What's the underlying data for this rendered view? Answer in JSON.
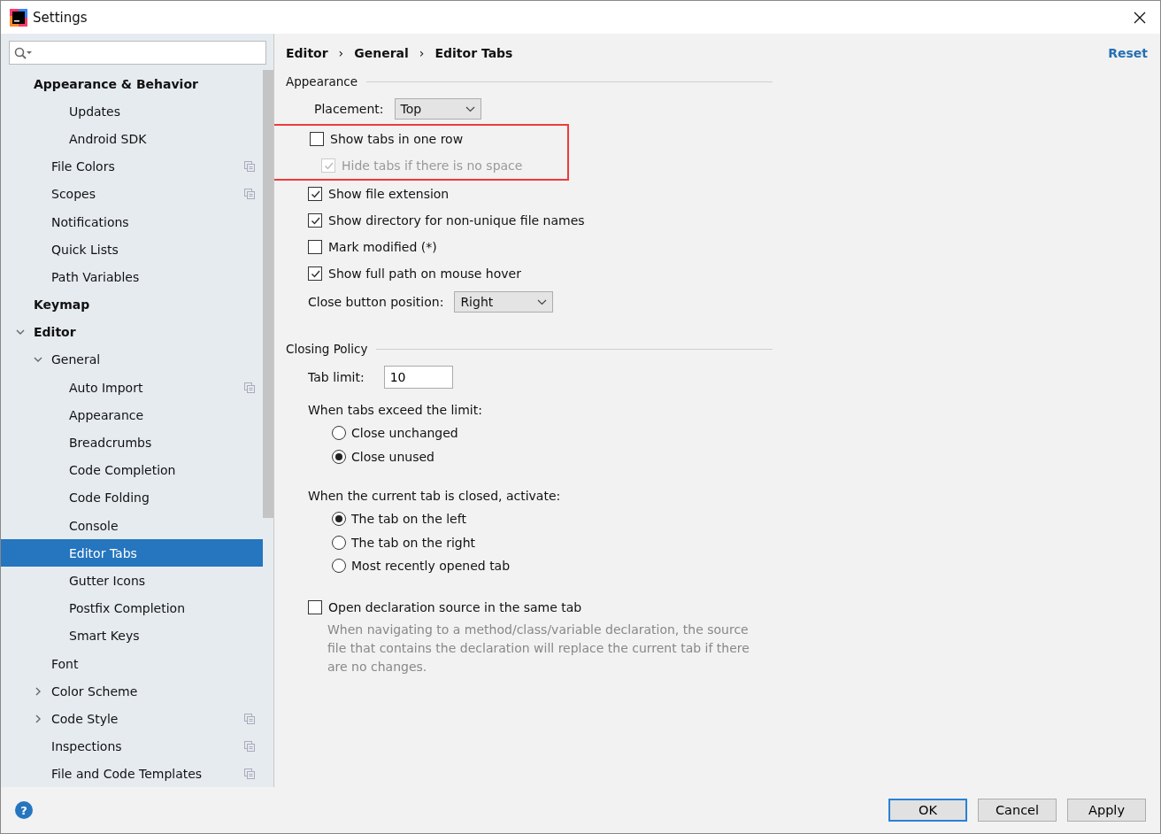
{
  "window": {
    "title": "Settings"
  },
  "sidebar": {
    "items": [
      {
        "label": "Appearance & Behavior",
        "bold": true,
        "selected": false,
        "scoped": false,
        "children": [
          {
            "children": [
              {
                "label": "Updates",
                "selected": false,
                "scoped": false
              },
              {
                "label": "Android SDK",
                "selected": false,
                "scoped": false
              }
            ]
          },
          {
            "label": "File Colors",
            "selected": false,
            "scoped": true
          },
          {
            "label": "Scopes",
            "selected": false,
            "scoped": true
          },
          {
            "label": "Notifications",
            "selected": false,
            "scoped": false
          },
          {
            "label": "Quick Lists",
            "selected": false,
            "scoped": false
          },
          {
            "label": "Path Variables",
            "selected": false,
            "scoped": false
          }
        ]
      },
      {
        "label": "Keymap",
        "bold": true,
        "selected": false,
        "scoped": false
      },
      {
        "label": "Editor",
        "bold": true,
        "expanded": true,
        "selected": false,
        "scoped": false,
        "children": [
          {
            "label": "General",
            "expanded": true,
            "selected": false,
            "scoped": false,
            "children": [
              {
                "label": "Auto Import",
                "selected": false,
                "scoped": true
              },
              {
                "label": "Appearance",
                "selected": false,
                "scoped": false
              },
              {
                "label": "Breadcrumbs",
                "selected": false,
                "scoped": false
              },
              {
                "label": "Code Completion",
                "selected": false,
                "scoped": false
              },
              {
                "label": "Code Folding",
                "selected": false,
                "scoped": false
              },
              {
                "label": "Console",
                "selected": false,
                "scoped": false
              },
              {
                "label": "Editor Tabs",
                "selected": true,
                "scoped": false
              },
              {
                "label": "Gutter Icons",
                "selected": false,
                "scoped": false
              },
              {
                "label": "Postfix Completion",
                "selected": false,
                "scoped": false
              },
              {
                "label": "Smart Keys",
                "selected": false,
                "scoped": false
              }
            ]
          },
          {
            "label": "Font",
            "selected": false,
            "scoped": false
          },
          {
            "label": "Color Scheme",
            "expanded": false,
            "selected": false,
            "scoped": false
          },
          {
            "label": "Code Style",
            "expanded": false,
            "selected": false,
            "scoped": true
          },
          {
            "label": "Inspections",
            "selected": false,
            "scoped": true
          },
          {
            "label": "File and Code Templates",
            "selected": false,
            "scoped": true
          }
        ]
      }
    ]
  },
  "breadcrumbs": [
    "Editor",
    "General",
    "Editor Tabs"
  ],
  "breadcrumb_separators": [
    "›",
    "›"
  ],
  "reset": "Reset",
  "sections": [
    {
      "title": "Appearance",
      "items": [
        {
          "kind": "dropdown",
          "label": "Placement:",
          "value": "Top",
          "indent": true
        },
        {
          "kind": "group",
          "highlighted": true,
          "items": [
            {
              "kind": "checkbox",
              "label": "Show tabs in one row",
              "checked": false,
              "disabled": false,
              "indent": false
            },
            {
              "kind": "checkbox",
              "label": "Hide tabs if there is no space",
              "checked": true,
              "disabled": true,
              "indent": true
            }
          ]
        },
        {
          "kind": "checkbox",
          "label": "Show file extension",
          "checked": true,
          "disabled": false,
          "indent": false
        },
        {
          "kind": "checkbox",
          "label": "Show directory for non-unique file names",
          "checked": true,
          "disabled": false,
          "indent": false
        },
        {
          "kind": "checkbox",
          "label": "Mark modified (*)",
          "checked": false,
          "disabled": false,
          "indent": false
        },
        {
          "kind": "checkbox",
          "label": "Show full path on mouse hover",
          "checked": true,
          "disabled": false,
          "indent": false
        },
        {
          "kind": "dropdown",
          "label": "Close button position:",
          "value": "Right",
          "indent": false
        }
      ]
    },
    {
      "title": "Closing Policy",
      "items": [
        {
          "kind": "textfield",
          "label": "Tab limit:",
          "value": "10"
        },
        {
          "kind": "radiogroup",
          "label": "When tabs exceed the limit:",
          "options": [
            {
              "label": "Close unchanged",
              "selected": false
            },
            {
              "label": "Close unused",
              "selected": true
            }
          ]
        },
        {
          "kind": "radiogroup",
          "label": "When the current tab is closed, activate:",
          "options": [
            {
              "label": "The tab on the left",
              "selected": true
            },
            {
              "label": "The tab on the right",
              "selected": false
            },
            {
              "label": "Most recently opened tab",
              "selected": false
            }
          ]
        },
        {
          "kind": "checkbox",
          "label": "Open declaration source in the same tab",
          "checked": false,
          "disabled": false,
          "indent": false,
          "description": "When navigating to a method/class/variable declaration, the source file that contains the declaration will replace the current tab if there are no changes."
        }
      ]
    }
  ],
  "help": "?",
  "buttons": [
    {
      "label": "OK",
      "default": true
    },
    {
      "label": "Cancel",
      "default": false
    },
    {
      "label": "Apply",
      "default": false
    }
  ]
}
